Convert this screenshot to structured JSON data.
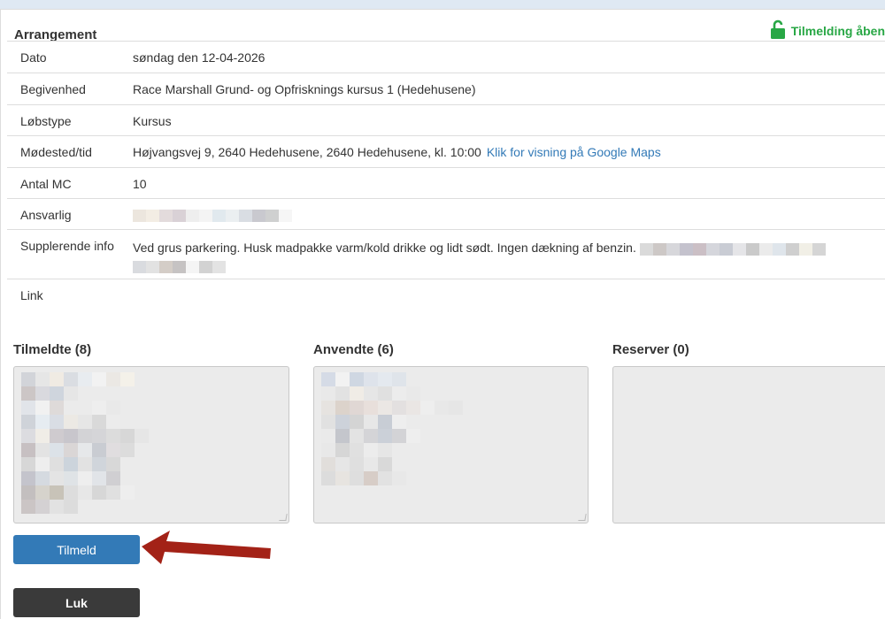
{
  "panel": {
    "title": "Arrangement",
    "status_label": "Tilmelding åben",
    "status_color": "#28a745",
    "status_icon": "unlock-icon"
  },
  "rows": [
    {
      "label": "Dato",
      "value": "søndag den 12-04-2026"
    },
    {
      "label": "Begivenhed",
      "value": "Race Marshall Grund- og Opfrisknings kursus 1 (Hedehusene)"
    },
    {
      "label": "Løbstype",
      "value": "Kursus"
    },
    {
      "label": "Mødested/tid",
      "value": "Højvangsvej 9, 2640 Hedehusene, 2640 Hedehusene,  kl. 10:00",
      "link": "Klik for visning på Google Maps"
    },
    {
      "label": "Antal MC",
      "value": "10"
    },
    {
      "label": "Ansvarlig",
      "value": ""
    },
    {
      "label": "Supplerende info",
      "value": "Ved grus parkering. Husk madpakke varm/kold drikke og lidt sødt. Ingen dækning af benzin."
    },
    {
      "label": "Link",
      "value": ""
    }
  ],
  "lists": {
    "registered": {
      "title": "Tilmeldte (8)"
    },
    "used": {
      "title": "Anvendte (6)"
    },
    "reserves": {
      "title": "Reserver (0)"
    }
  },
  "buttons": {
    "register": "Tilmeld",
    "close": "Luk",
    "primary_color": "#337ab7"
  }
}
